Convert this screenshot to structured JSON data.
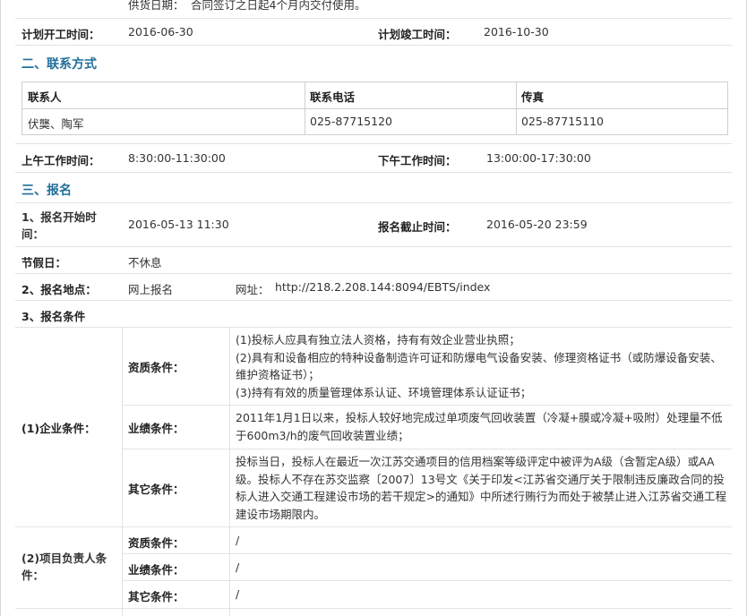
{
  "top": {
    "supply_label": "供货日期：",
    "supply_value": "合同签订之日起4个月内交付使用。"
  },
  "plan": {
    "start_label": "计划开工时间：",
    "start_value": "2016-06-30",
    "end_label": "计划竣工时间：",
    "end_value": "2016-10-30"
  },
  "section2": {
    "title": "二、联系方式"
  },
  "contact_table": {
    "headers": [
      "联系人",
      "联系电话",
      "传真"
    ],
    "row": [
      "伏龑、陶军",
      "025-87715120",
      "025-87715110"
    ]
  },
  "work_time": {
    "am_label": "上午工作时间：",
    "am_value": "8:30:00-11:30:00",
    "pm_label": "下午工作时间：",
    "pm_value": "13:00:00-17:30:00"
  },
  "section3": {
    "title": "三、报名"
  },
  "signup": {
    "start_label": "1、报名开始时间：",
    "start_value": "2016-05-13 11:30",
    "end_label": "报名截止时间：",
    "end_value": "2016-05-20 23:59",
    "holiday_label": "节假日：",
    "holiday_value": "不休息",
    "place_label": "2、报名地点：",
    "place_value": "网上报名",
    "url_label": "网址：",
    "url_value": "http://218.2.208.144:8094/EBTS/index",
    "cond_label": "3、报名条件"
  },
  "company": {
    "label": "(1)企业条件：",
    "qual_label": "资质条件：",
    "qual_lines": [
      "(1)投标人应具有独立法人资格，持有有效企业营业执照；",
      "(2)具有和设备相应的特种设备制造许可证和防爆电气设备安装、修理资格证书（或防爆设备安装、维护资格证书）；",
      "(3)持有有效的质量管理体系认证、环境管理体系认证证书；"
    ],
    "perf_label": "业绩条件：",
    "perf_value": "2011年1月1日以来，投标人较好地完成过单项废气回收装置（冷凝+膜或冷凝+吸附）处理量不低于600m3/h的废气回收装置业绩；",
    "other_label": "其它条件：",
    "other_value": "投标当日，投标人在最近一次江苏交通项目的信用档案等级评定中被评为A级（含暂定A级）或AA级。投标人不存在苏交监察〔2007〕13号文《关于印发<江苏省交通厅关于限制违反廉政合同的投标人进入交通工程建设市场的若干规定>的通知》中所述行贿行为而处于被禁止进入江苏省交通工程建设市场期限内。"
  },
  "manager": {
    "label": "(2)项目负责人条件：",
    "qual_label": "资质条件：",
    "qual_value": "/",
    "perf_label": "业绩条件：",
    "perf_value": "/",
    "other_label": "其它条件：",
    "other_value": "/"
  }
}
